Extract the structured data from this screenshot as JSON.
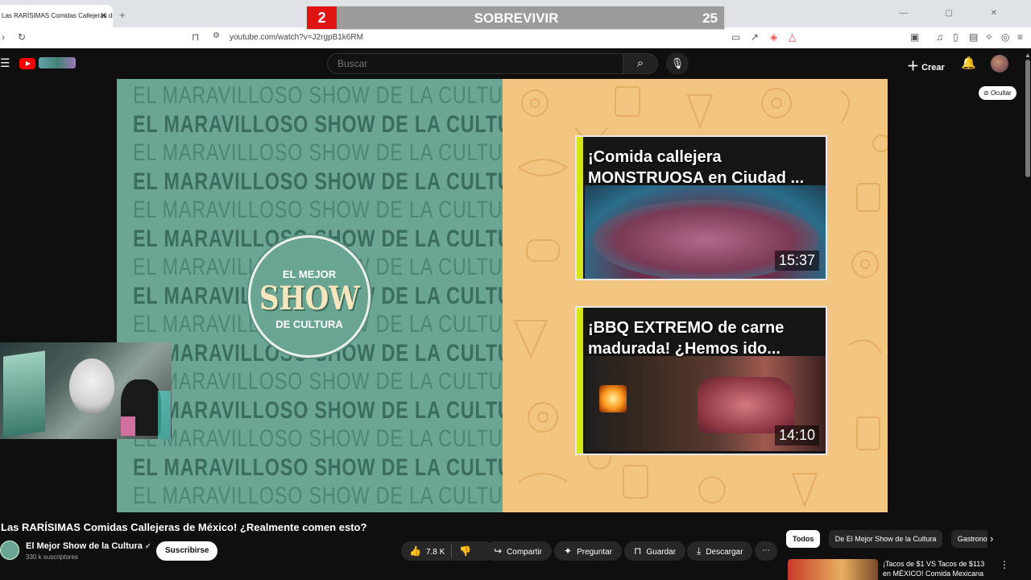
{
  "browser": {
    "tab_title": "Las RARÍSIMAS Comidas Callejeras de México! ¿Realmente comen esto?",
    "url": "youtube.com/watch?v=J2rgpB1k6RM"
  },
  "overlay": {
    "current": "2",
    "label": "SOBREVIVIR",
    "total": "25"
  },
  "header": {
    "search_placeholder": "Buscar",
    "create_label": "Crear"
  },
  "video": {
    "wall_text": "EL MARAVILLOSO SHOW DE LA CULTURA",
    "logo_top": "EL MEJOR",
    "logo_main": "SHOW",
    "logo_bottom": "DE CULTURA",
    "end_cards": [
      {
        "title": "¡Comida callejera MONSTRUOSA en Ciudad ...",
        "duration": "15:37"
      },
      {
        "title": "¡BBQ EXTREMO de carne madurada! ¿Hemos ido...",
        "duration": "14:10"
      }
    ],
    "hide_label": "Ocultar"
  },
  "info": {
    "title": "Las RARÍSIMAS Comidas Callejeras de México! ¿Realmente comen esto?",
    "channel_name": "El Mejor Show de la Cultura",
    "subscribers": "330 k suscriptores",
    "subscribe_label": "Suscribirse",
    "likes": "7.8 K",
    "share_label": "Compartir",
    "ask_label": "Preguntar",
    "save_label": "Guardar",
    "download_label": "Descargar"
  },
  "chips": [
    "Todos",
    "De El Mejor Show de la Cultura",
    "Gastronomía"
  ],
  "recommendation": {
    "title": "¡Tacos de $1 VS Tacos de $113 en MÉXICO! Comida Mexicana"
  },
  "colors": {
    "accent": "#ff0000",
    "overlay_red": "#e11414",
    "teal_panel": "#6ba593",
    "peach_panel": "#f2c680",
    "card_accent": "#d7e41c"
  }
}
